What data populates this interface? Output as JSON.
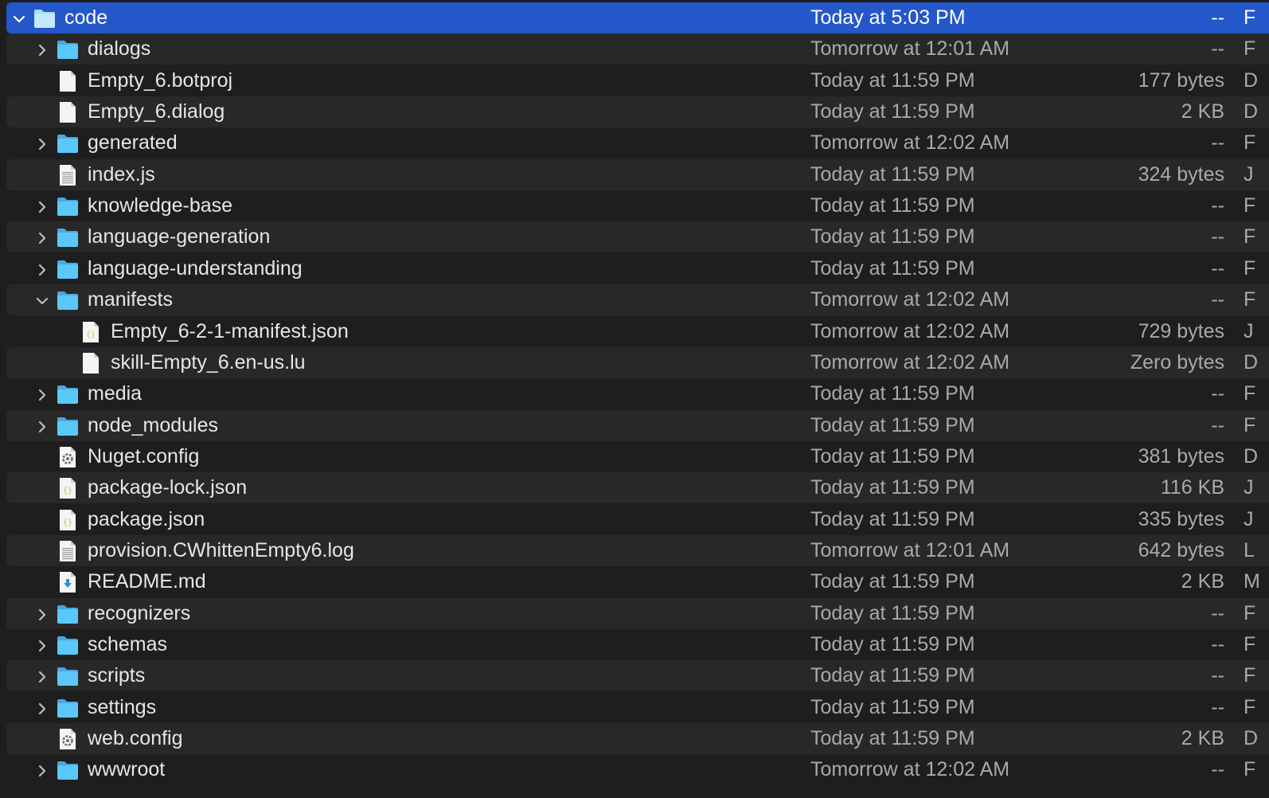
{
  "colors": {
    "window_background": "#1e1e1e",
    "row_stripe": "#282828",
    "selection": "#2457c9",
    "folder_blue": "#5ac8fa",
    "secondary_text": "#a9a9a9"
  },
  "rows": [
    {
      "name": "code",
      "date": "Today at 5:03 PM",
      "size": "--",
      "kind_hint": "F",
      "type": "folder",
      "expanded": true,
      "depth": 0,
      "selected": true
    },
    {
      "name": "dialogs",
      "date": "Tomorrow at 12:01 AM",
      "size": "--",
      "kind_hint": "F",
      "type": "folder",
      "expanded": false,
      "depth": 1
    },
    {
      "name": "Empty_6.botproj",
      "date": "Today at 11:59 PM",
      "size": "177 bytes",
      "kind_hint": "D",
      "type": "file",
      "depth": 1
    },
    {
      "name": "Empty_6.dialog",
      "date": "Today at 11:59 PM",
      "size": "2 KB",
      "kind_hint": "D",
      "type": "file",
      "depth": 1
    },
    {
      "name": "generated",
      "date": "Tomorrow at 12:02 AM",
      "size": "--",
      "kind_hint": "F",
      "type": "folder",
      "expanded": false,
      "depth": 1
    },
    {
      "name": "index.js",
      "date": "Today at 11:59 PM",
      "size": "324 bytes",
      "kind_hint": "J",
      "type": "text",
      "depth": 1
    },
    {
      "name": "knowledge-base",
      "date": "Today at 11:59 PM",
      "size": "--",
      "kind_hint": "F",
      "type": "folder",
      "expanded": false,
      "depth": 1
    },
    {
      "name": "language-generation",
      "date": "Today at 11:59 PM",
      "size": "--",
      "kind_hint": "F",
      "type": "folder",
      "expanded": false,
      "depth": 1
    },
    {
      "name": "language-understanding",
      "date": "Today at 11:59 PM",
      "size": "--",
      "kind_hint": "F",
      "type": "folder",
      "expanded": false,
      "depth": 1
    },
    {
      "name": "manifests",
      "date": "Tomorrow at 12:02 AM",
      "size": "--",
      "kind_hint": "F",
      "type": "folder",
      "expanded": true,
      "depth": 1
    },
    {
      "name": "Empty_6-2-1-manifest.json",
      "date": "Tomorrow at 12:02 AM",
      "size": "729 bytes",
      "kind_hint": "J",
      "type": "json",
      "depth": 2
    },
    {
      "name": "skill-Empty_6.en-us.lu",
      "date": "Tomorrow at 12:02 AM",
      "size": "Zero bytes",
      "kind_hint": "D",
      "type": "file",
      "depth": 2
    },
    {
      "name": "media",
      "date": "Today at 11:59 PM",
      "size": "--",
      "kind_hint": "F",
      "type": "folder",
      "expanded": false,
      "depth": 1
    },
    {
      "name": "node_modules",
      "date": "Today at 11:59 PM",
      "size": "--",
      "kind_hint": "F",
      "type": "folder",
      "expanded": false,
      "depth": 1
    },
    {
      "name": "Nuget.config",
      "date": "Today at 11:59 PM",
      "size": "381 bytes",
      "kind_hint": "D",
      "type": "config",
      "depth": 1
    },
    {
      "name": "package-lock.json",
      "date": "Today at 11:59 PM",
      "size": "116 KB",
      "kind_hint": "J",
      "type": "json",
      "depth": 1
    },
    {
      "name": "package.json",
      "date": "Today at 11:59 PM",
      "size": "335 bytes",
      "kind_hint": "J",
      "type": "json",
      "depth": 1
    },
    {
      "name": "provision.CWhittenEmpty6.log",
      "date": "Tomorrow at 12:01 AM",
      "size": "642 bytes",
      "kind_hint": "L",
      "type": "text",
      "depth": 1
    },
    {
      "name": "README.md",
      "date": "Today at 11:59 PM",
      "size": "2 KB",
      "kind_hint": "M",
      "type": "markdown",
      "depth": 1
    },
    {
      "name": "recognizers",
      "date": "Today at 11:59 PM",
      "size": "--",
      "kind_hint": "F",
      "type": "folder",
      "expanded": false,
      "depth": 1
    },
    {
      "name": "schemas",
      "date": "Today at 11:59 PM",
      "size": "--",
      "kind_hint": "F",
      "type": "folder",
      "expanded": false,
      "depth": 1
    },
    {
      "name": "scripts",
      "date": "Today at 11:59 PM",
      "size": "--",
      "kind_hint": "F",
      "type": "folder",
      "expanded": false,
      "depth": 1
    },
    {
      "name": "settings",
      "date": "Today at 11:59 PM",
      "size": "--",
      "kind_hint": "F",
      "type": "folder",
      "expanded": false,
      "depth": 1
    },
    {
      "name": "web.config",
      "date": "Today at 11:59 PM",
      "size": "2 KB",
      "kind_hint": "D",
      "type": "config",
      "depth": 1
    },
    {
      "name": "wwwroot",
      "date": "Tomorrow at 12:02 AM",
      "size": "--",
      "kind_hint": "F",
      "type": "folder",
      "expanded": false,
      "depth": 1
    }
  ]
}
